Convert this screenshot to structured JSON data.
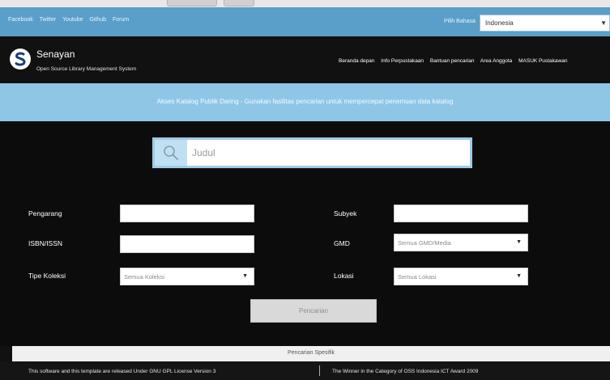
{
  "topbar": {
    "links": [
      "Facebook",
      "Twitter",
      "Youtube",
      "Github",
      "Forum"
    ],
    "language_label": "Pilih Bahasa",
    "language_selected": "Indonesia"
  },
  "header": {
    "brand_name": "Senayan",
    "brand_tagline": "Open Source Library Management System",
    "nav": [
      "Beranda depan",
      "Info Perpustakaan",
      "Bantuan pencarian",
      "Area Anggota",
      "MASUK Pustakawan"
    ]
  },
  "banner": {
    "text": "Akses Katalog Publik Daring - Gunakan fasilitas pencarian untuk mempercepat penemuan data katalog"
  },
  "search": {
    "placeholder": "Judul"
  },
  "form": {
    "author_label": "Pengarang",
    "subject_label": "Subyek",
    "isbn_label": "ISBN/ISSN",
    "gmd_label": "GMD",
    "gmd_selected": "Semua GMD/Media",
    "collection_type_label": "Tipe Koleksi",
    "collection_type_selected": "Semua Koleksi",
    "location_label": "Lokasi",
    "location_selected": "Semua Lokasi",
    "submit_label": "Pencarian"
  },
  "specific_search_label": "Pencarian Spesifik",
  "footer": {
    "license_text": "This software and this template are released Under GNU GPL License Version 3",
    "award_text": "The Winner in the Category of OSS Indonesia ICT Award 2009"
  }
}
